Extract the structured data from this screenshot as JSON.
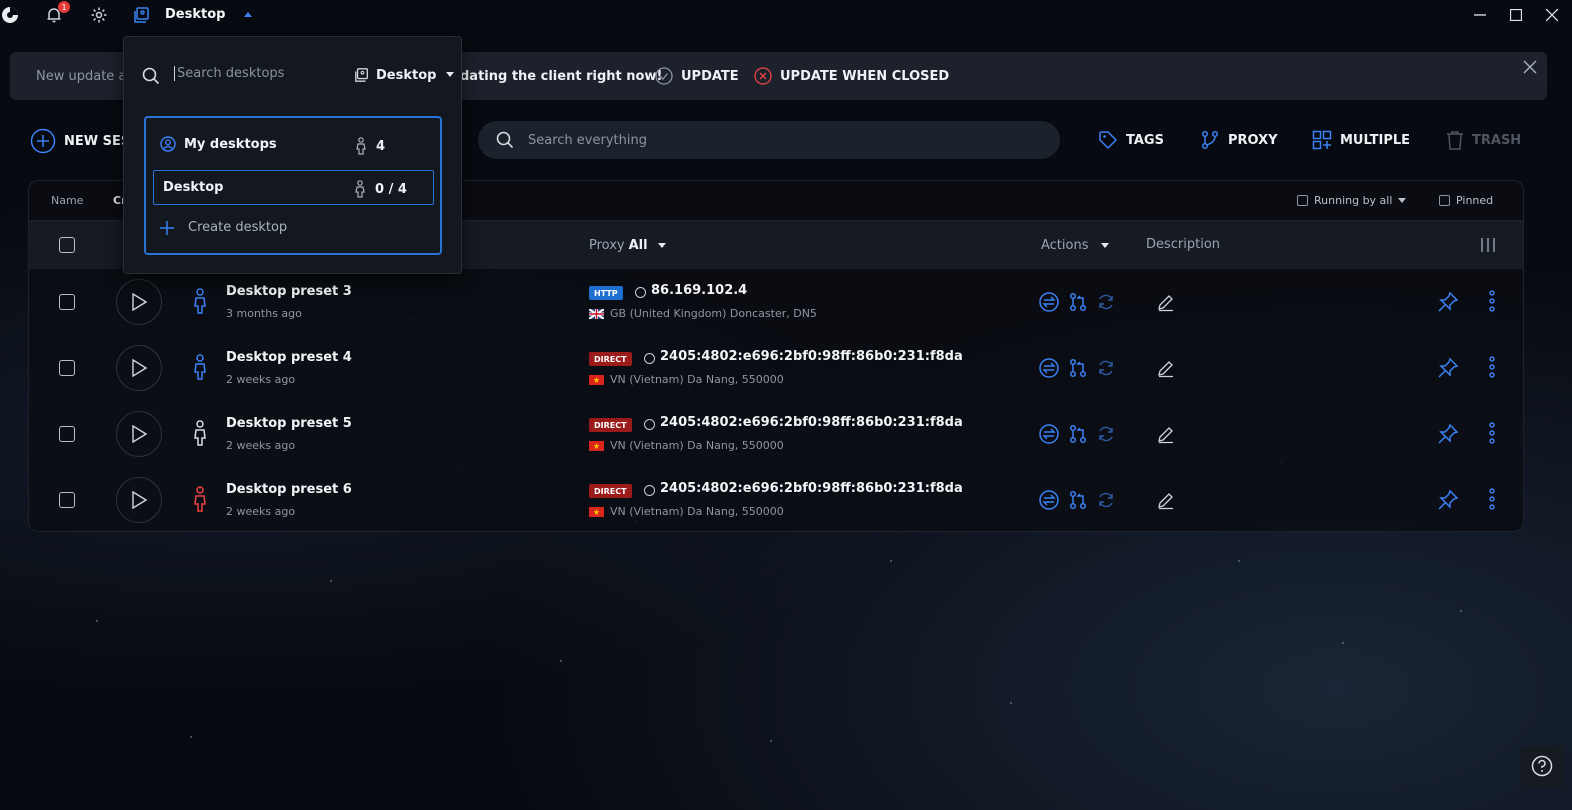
{
  "titlebar": {
    "notifications_count": "1",
    "current_desktop": "Desktop"
  },
  "banner": {
    "text_start": "New update a",
    "text_end": "dating the client right now!",
    "update_label": "UPDATE",
    "update_when_closed_label": "UPDATE WHEN CLOSED"
  },
  "toolbar": {
    "new_session_label": "NEW SES",
    "search_placeholder": "Search everything",
    "tags_label": "TAGS",
    "proxy_label": "PROXY",
    "multiple_label": "MULTIPLE",
    "trash_label": "TRASH"
  },
  "table": {
    "sort_name": "Name",
    "sort_cr": "Cr",
    "filter_running": "Running by all",
    "filter_pinned": "Pinned",
    "col_proxy": "Proxy",
    "col_proxy_filter": "All",
    "col_actions": "Actions",
    "col_description": "Description",
    "rows": [
      {
        "name": "Desktop preset 3",
        "time": "3 months ago",
        "proxy_type": "HTTP",
        "ip": "86.169.102.4",
        "location": "GB (United Kingdom) Doncaster, DN5",
        "person_color": "#3b82f6"
      },
      {
        "name": "Desktop preset 4",
        "time": "2 weeks ago",
        "proxy_type": "DIRECT",
        "ip": "2405:4802:e696:2bf0:98ff:86b0:231:f8da",
        "location": "VN (Vietnam) Da Nang, 550000",
        "person_color": "#3b82f6"
      },
      {
        "name": "Desktop preset 5",
        "time": "2 weeks ago",
        "proxy_type": "DIRECT",
        "ip": "2405:4802:e696:2bf0:98ff:86b0:231:f8da",
        "location": "VN (Vietnam) Da Nang, 550000",
        "person_color": "#d9dde3"
      },
      {
        "name": "Desktop preset 6",
        "time": "2 weeks ago",
        "proxy_type": "DIRECT",
        "ip": "2405:4802:e696:2bf0:98ff:86b0:231:f8da",
        "location": "VN (Vietnam) Da Nang, 550000",
        "person_color": "#ef4444"
      }
    ]
  },
  "dropdown": {
    "search_placeholder": "Search desktops",
    "select_value": "Desktop",
    "group_label": "My desktops",
    "group_count": "4",
    "item_name": "Desktop",
    "item_count": "0 / 4",
    "create_label": "Create desktop"
  },
  "colors": {
    "accent": "#2a72d8",
    "http_badge": "#1f6fd1",
    "direct_badge": "#9b1b1b"
  }
}
